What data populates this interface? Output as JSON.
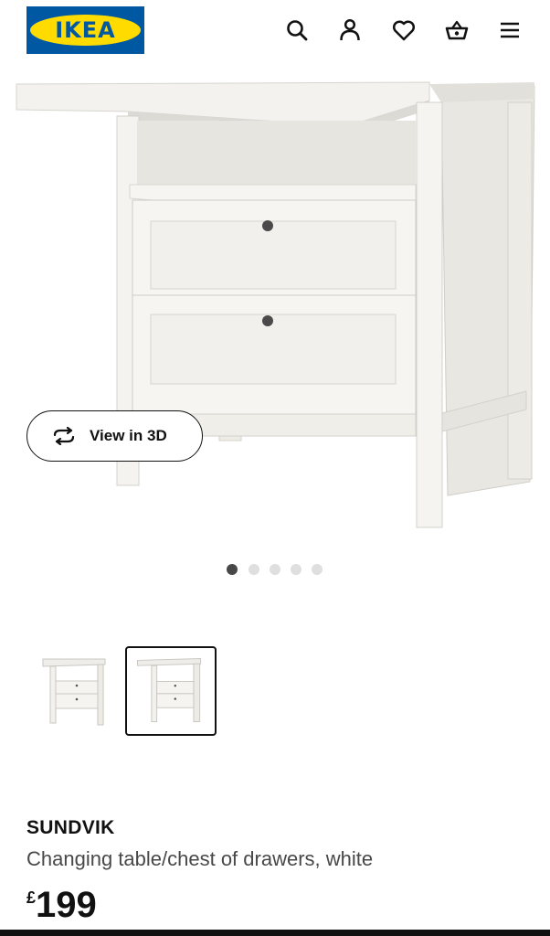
{
  "header": {
    "logo_text": "IKEA",
    "icons": [
      "search-icon",
      "account-icon",
      "heart-icon",
      "basket-icon",
      "menu-icon"
    ]
  },
  "gallery": {
    "view_3d_label": "View in 3D",
    "dots": {
      "count": 5,
      "active": 0
    },
    "thumbnails": [
      {
        "selected": false
      },
      {
        "selected": true
      }
    ]
  },
  "product": {
    "name": "SUNDVIK",
    "description": "Changing table/chest of drawers, white",
    "currency": "£",
    "price": "199"
  },
  "colors": {
    "ikea_blue": "#0058a3",
    "ikea_yellow": "#ffdb00",
    "text_primary": "#111111",
    "text_secondary": "#484848",
    "dot_active": "#484848",
    "dot_inactive": "#dfdfdf"
  }
}
